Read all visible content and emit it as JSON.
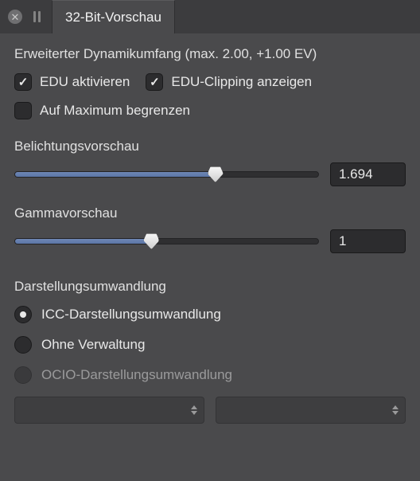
{
  "tab": {
    "title": "32-Bit-Vorschau"
  },
  "header": {
    "label": "Erweiterter Dynamikumfang (max. 2.00, +1.00 EV)"
  },
  "checks": {
    "enable": {
      "label": "EDU aktivieren",
      "checked": true
    },
    "clipping": {
      "label": "EDU-Clipping anzeigen",
      "checked": true
    },
    "clamp": {
      "label": "Auf Maximum begrenzen",
      "checked": false
    }
  },
  "sliders": {
    "exposure": {
      "label": "Belichtungsvorschau",
      "value": "1.694",
      "percent": 66
    },
    "gamma": {
      "label": "Gammavorschau",
      "value": "1",
      "percent": 45
    }
  },
  "render": {
    "heading": "Darstellungsumwandlung",
    "options": {
      "icc": {
        "label": "ICC-Darstellungsumwandlung",
        "selected": true,
        "disabled": false
      },
      "none": {
        "label": "Ohne Verwaltung",
        "selected": false,
        "disabled": false
      },
      "ocio": {
        "label": "OCIO-Darstellungsumwandlung",
        "selected": false,
        "disabled": true
      }
    }
  }
}
